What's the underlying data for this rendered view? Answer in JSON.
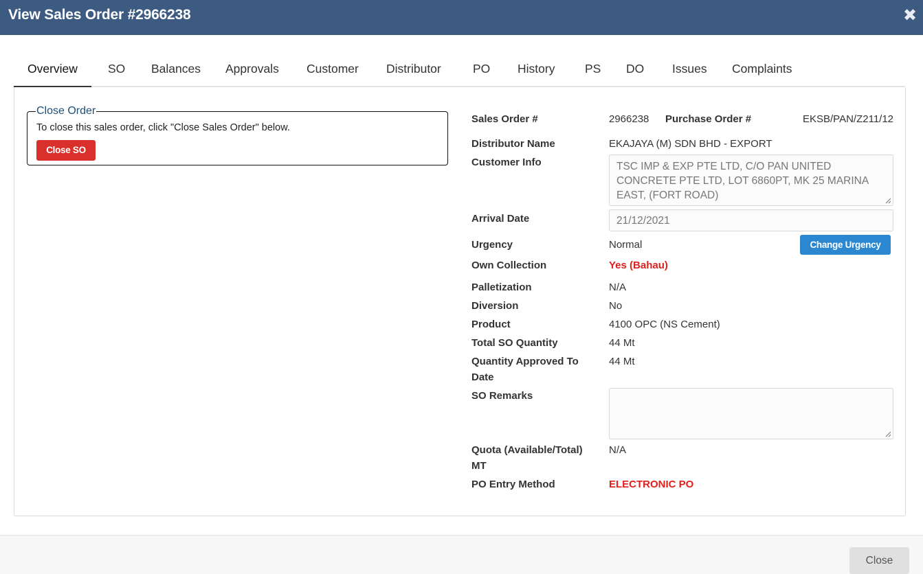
{
  "window": {
    "title": "View Sales Order #2966238",
    "close_icon": "close-icon"
  },
  "tabs": [
    {
      "label": "Overview"
    },
    {
      "label": "SO"
    },
    {
      "label": "Balances"
    },
    {
      "label": "Approvals"
    },
    {
      "label": "Customer"
    },
    {
      "label": "Distributor"
    },
    {
      "label": "PO"
    },
    {
      "label": "History"
    },
    {
      "label": "PS"
    },
    {
      "label": "DO"
    },
    {
      "label": "Issues"
    },
    {
      "label": "Complaints"
    }
  ],
  "active_tab": "Overview",
  "close_order": {
    "legend": "Close Order",
    "text": "To close this sales order, click \"Close Sales Order\" below.",
    "button": "Close SO"
  },
  "details": {
    "sales_order_label": "Sales Order #",
    "sales_order_value": "2966238",
    "purchase_order_label": "Purchase Order #",
    "purchase_order_value": "EKSB/PAN/Z211/12",
    "distributor_label": "Distributor Name",
    "distributor_value": "EKAJAYA (M) SDN BHD - EXPORT",
    "customer_label": "Customer Info",
    "customer_value": "TSC IMP & EXP PTE LTD, C/O PAN UNITED CONCRETE PTE LTD, LOT 6860PT, MK 25 MARINA EAST, (FORT ROAD)",
    "arrival_label": "Arrival Date",
    "arrival_value": "21/12/2021",
    "urgency_label": "Urgency",
    "urgency_value": "Normal",
    "change_urgency_button": "Change Urgency",
    "own_collection_label": "Own Collection",
    "own_collection_value": "Yes (Bahau)",
    "palletization_label": "Palletization",
    "palletization_value": "N/A",
    "diversion_label": "Diversion",
    "diversion_value": "No",
    "product_label": "Product",
    "product_value": "4100 OPC (NS Cement)",
    "total_qty_label": "Total SO Quantity",
    "total_qty_value": "44 Mt",
    "approved_qty_label": "Quantity Approved To Date",
    "approved_qty_value": "44 Mt",
    "remarks_label": "SO Remarks",
    "remarks_value": "",
    "quota_label": "Quota (Available/Total) MT",
    "quota_value": "N/A",
    "po_entry_label": "PO Entry Method",
    "po_entry_value": "ELECTRONIC PO"
  },
  "colors": {
    "title_bar": "#3d5a80",
    "danger": "#d9302b",
    "primary": "#2b88d0",
    "highlight_text": "#e0201c"
  },
  "footer": {
    "close_button": "Close"
  }
}
